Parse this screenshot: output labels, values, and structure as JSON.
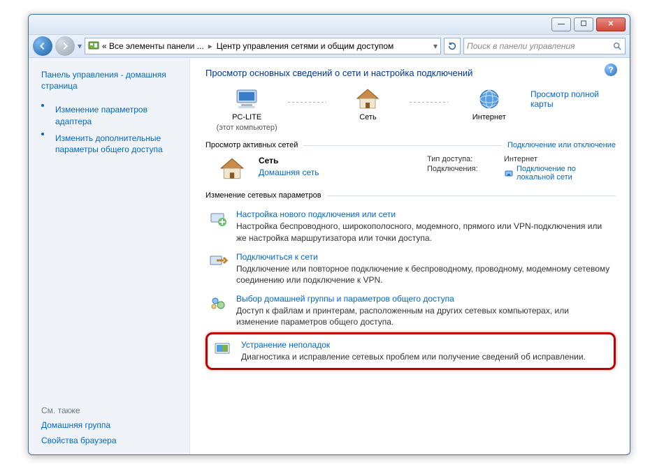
{
  "titlebar": {
    "min": "—",
    "max": "☐",
    "close": "✕"
  },
  "nav": {
    "crumb1": "« Все элементы панели ...",
    "crumb2": "Центр управления сетями и общим доступом",
    "search_placeholder": "Поиск в панели управления"
  },
  "sidebar": {
    "home": "Панель управления - домашняя страница",
    "item1": "Изменение параметров адаптера",
    "item2": "Изменить дополнительные параметры общего доступа",
    "see_also": "См. также",
    "item3": "Домашняя группа",
    "item4": "Свойства браузера"
  },
  "content": {
    "heading": "Просмотр основных сведений о сети и настройка подключений",
    "full_map": "Просмотр полной карты",
    "map": {
      "pc_name": "PC-LITE",
      "pc_sub": "(этот компьютер)",
      "net_name": "Сеть",
      "inet_name": "Интернет"
    },
    "active_header": "Просмотр активных сетей",
    "connect_link": "Подключение или отключение",
    "active": {
      "name": "Сеть",
      "type": "Домашняя сеть",
      "access_label": "Тип доступа:",
      "access_value": "Интернет",
      "conn_label": "Подключения:",
      "conn_value": "Подключение по локальной сети"
    },
    "settings_header": "Изменение сетевых параметров",
    "tasks": [
      {
        "title": "Настройка нового подключения или сети",
        "desc": "Настройка беспроводного, широкополосного, модемного, прямого или VPN-подключения или же настройка маршрутизатора или точки доступа."
      },
      {
        "title": "Подключиться к сети",
        "desc": "Подключение или повторное подключение к беспроводному, проводному, модемному сетевому соединению или подключение к VPN."
      },
      {
        "title": "Выбор домашней группы и параметров общего доступа",
        "desc": "Доступ к файлам и принтерам, расположенным на других сетевых компьютерах, или изменение параметров общего доступа."
      },
      {
        "title": "Устранение неполадок",
        "desc": "Диагностика и исправление сетевых проблем или получение сведений об исправлении."
      }
    ]
  }
}
